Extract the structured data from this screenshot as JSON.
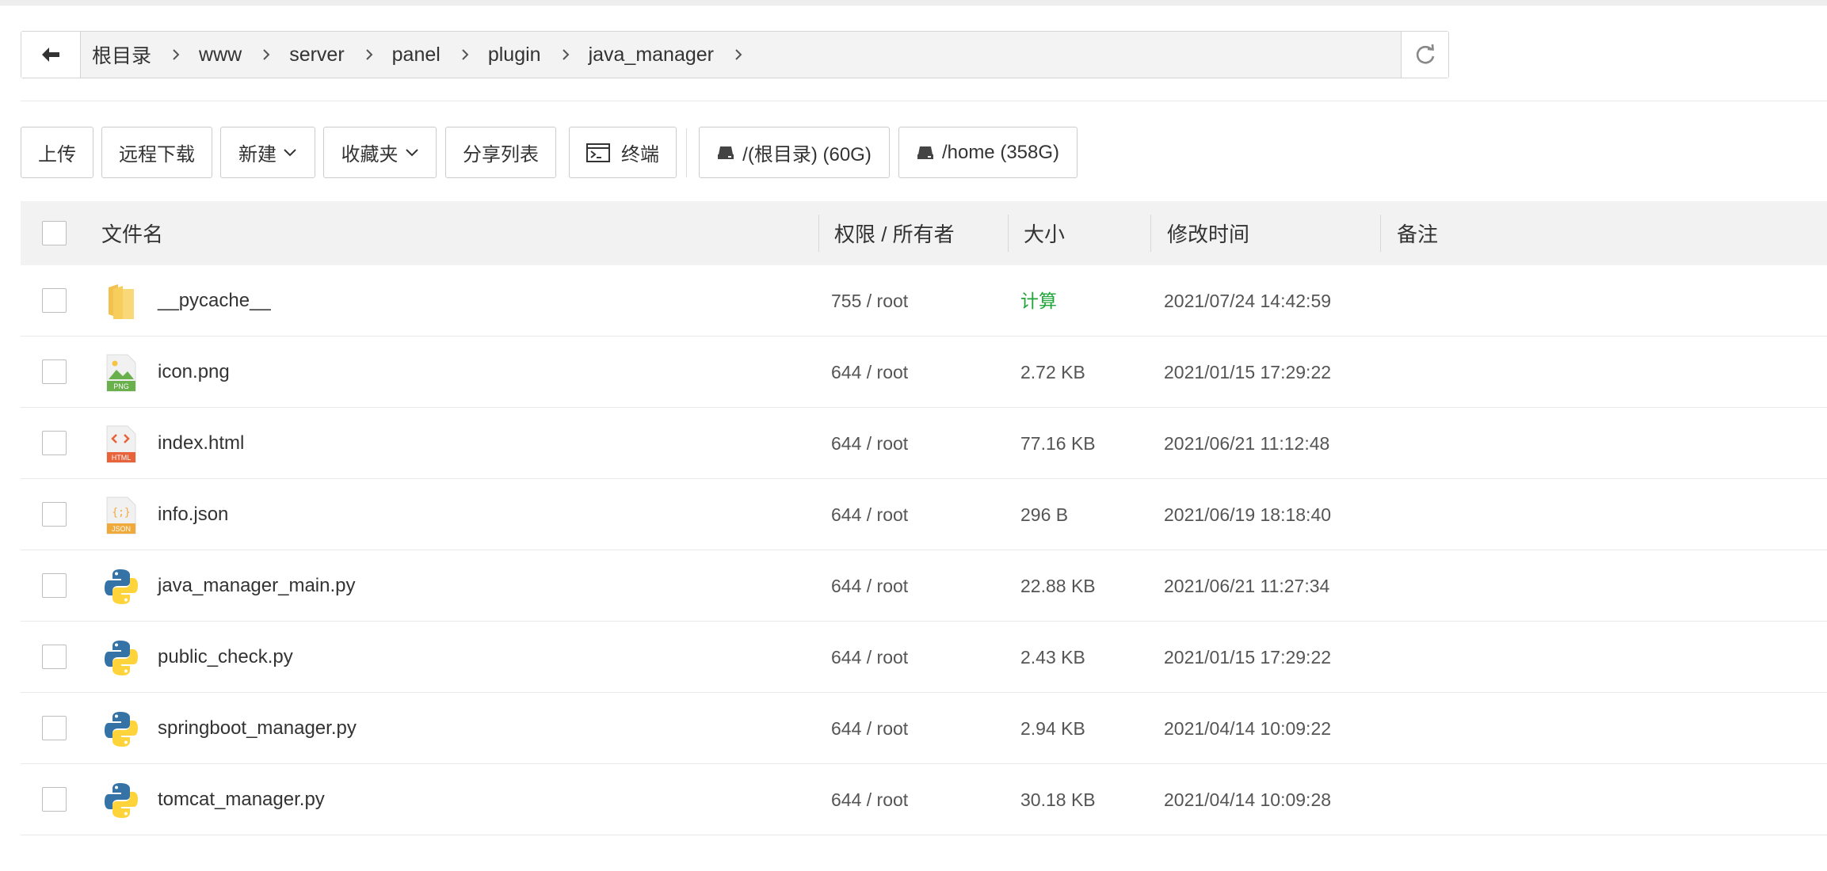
{
  "breadcrumb": {
    "items": [
      "根目录",
      "www",
      "server",
      "panel",
      "plugin",
      "java_manager"
    ]
  },
  "toolbar": {
    "upload_label": "上传",
    "remote_download_label": "远程下载",
    "new_label": "新建",
    "favorites_label": "收藏夹",
    "share_list_label": "分享列表",
    "terminal_label": "终端",
    "disk_root_label": "/(根目录) (60G)",
    "disk_home_label": "/home (358G)"
  },
  "table": {
    "headers": {
      "name": "文件名",
      "perm": "权限 / 所有者",
      "size": "大小",
      "mtime": "修改时间",
      "note": "备注"
    },
    "rows": [
      {
        "name": "__pycache__",
        "perm": "755 / root",
        "size": "计算",
        "mtime": "2021/07/24 14:42:59",
        "icon": "folder-icon"
      },
      {
        "name": "icon.png",
        "perm": "644 / root",
        "size": "2.72 KB",
        "mtime": "2021/01/15 17:29:22",
        "icon": "png-file-icon"
      },
      {
        "name": "index.html",
        "perm": "644 / root",
        "size": "77.16 KB",
        "mtime": "2021/06/21 11:12:48",
        "icon": "html-file-icon"
      },
      {
        "name": "info.json",
        "perm": "644 / root",
        "size": "296 B",
        "mtime": "2021/06/19 18:18:40",
        "icon": "json-file-icon"
      },
      {
        "name": "java_manager_main.py",
        "perm": "644 / root",
        "size": "22.88 KB",
        "mtime": "2021/06/21 11:27:34",
        "icon": "python-file-icon"
      },
      {
        "name": "public_check.py",
        "perm": "644 / root",
        "size": "2.43 KB",
        "mtime": "2021/01/15 17:29:22",
        "icon": "python-file-icon"
      },
      {
        "name": "springboot_manager.py",
        "perm": "644 / root",
        "size": "2.94 KB",
        "mtime": "2021/04/14 10:09:22",
        "icon": "python-file-icon"
      },
      {
        "name": "tomcat_manager.py",
        "perm": "644 / root",
        "size": "30.18 KB",
        "mtime": "2021/04/14 10:09:28",
        "icon": "python-file-icon"
      }
    ]
  },
  "colors": {
    "calc_green": "#20a53a",
    "header_bg": "#f2f2f2",
    "folder_yellow": "#f7d26b",
    "python_blue": "#3572a5",
    "python_yellow": "#ffd43b"
  }
}
